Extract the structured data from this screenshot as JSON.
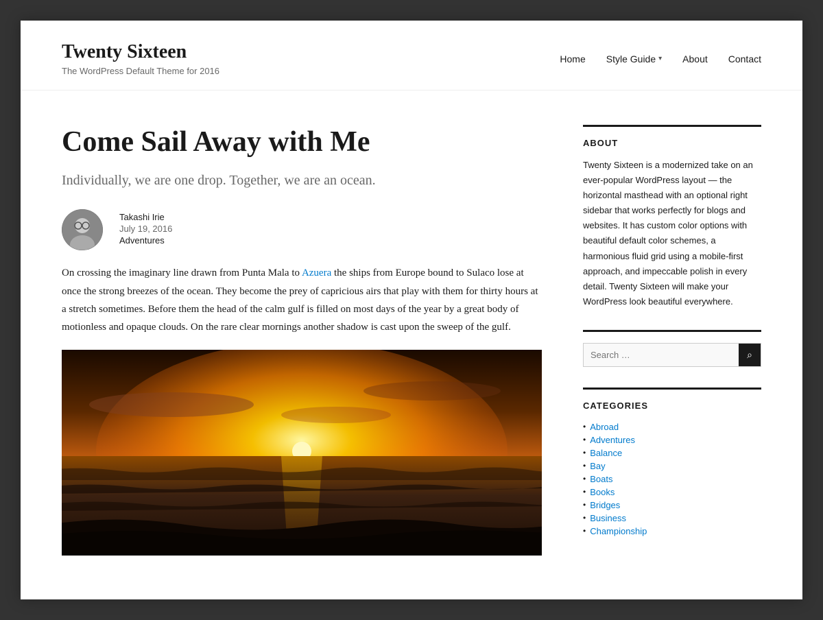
{
  "site": {
    "title": "Twenty Sixteen",
    "description": "The WordPress Default Theme for 2016"
  },
  "nav": {
    "items": [
      {
        "label": "Home",
        "id": "home"
      },
      {
        "label": "Style Guide",
        "id": "style-guide",
        "has_dropdown": true
      },
      {
        "label": "About",
        "id": "about"
      },
      {
        "label": "Contact",
        "id": "contact"
      }
    ]
  },
  "post": {
    "title": "Come Sail Away with Me",
    "subtitle": "Individually, we are one drop. Together, we are an ocean.",
    "author": "Takashi Irie",
    "date": "July 19, 2016",
    "category": "Adventures",
    "content": "On crossing the imaginary line drawn from Punta Mala to Azuera the ships from Europe bound to Sulaco lose at once the strong breezes of the ocean. They become the prey of capricious airs that play with them for thirty hours at a stretch sometimes. Before them the head of the calm gulf is filled on most days of the year by a great body of motionless and opaque clouds. On the rare clear mornings another shadow is cast upon the sweep of the gulf.",
    "content_link_text": "Azuera",
    "content_before_link": "On crossing the imaginary line drawn from Punta Mala to ",
    "content_after_link": " the ships from Europe bound to Sulaco lose at once the strong breezes of the ocean. They become the prey of capricious airs that play with them for thirty hours at a stretch sometimes. Before them the head of the calm gulf is filled on most days of the year by a great body of motionless and opaque clouds. On the rare clear mornings another shadow is cast upon the sweep of the gulf."
  },
  "sidebar": {
    "about": {
      "title": "ABOUT",
      "text": "Twenty Sixteen is a modernized take on an ever-popular WordPress layout — the horizontal masthead with an optional right sidebar that works perfectly for blogs and websites. It has custom color options with beautiful default color schemes, a harmonious fluid grid using a mobile-first approach, and impeccable polish in every detail. Twenty Sixteen will make your WordPress look beautiful everywhere."
    },
    "search": {
      "placeholder": "Search …"
    },
    "categories": {
      "title": "CATEGORIES",
      "items": [
        {
          "label": "Abroad"
        },
        {
          "label": "Adventures"
        },
        {
          "label": "Balance"
        },
        {
          "label": "Bay"
        },
        {
          "label": "Boats"
        },
        {
          "label": "Books"
        },
        {
          "label": "Bridges"
        },
        {
          "label": "Business"
        },
        {
          "label": "Championship"
        }
      ]
    }
  }
}
